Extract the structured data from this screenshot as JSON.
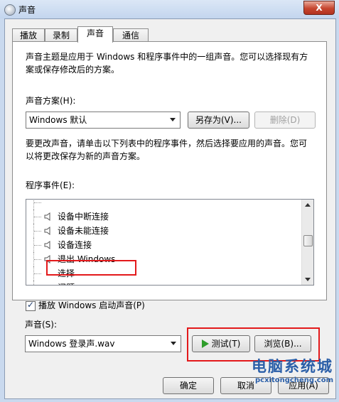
{
  "window": {
    "title": "声音",
    "close_label": "X"
  },
  "tabs": [
    {
      "label": "播放"
    },
    {
      "label": "录制"
    },
    {
      "label": "声音"
    },
    {
      "label": "通信"
    }
  ],
  "description": {
    "line1": "声音主题是应用于 Windows 和程序事件中的一组声音。您可以选择现有方",
    "line2": "案或保存修改后的方案。"
  },
  "scheme": {
    "label": "声音方案(H):",
    "value": "Windows 默认",
    "save_as_label": "另存为(V)...",
    "delete_label": "删除(D)"
  },
  "instructions": {
    "line1": "要更改声音，请单击以下列表中的程序事件，然后选择要应用的声音。您可",
    "line2": "以将更改保存为新的声音方案。"
  },
  "events": {
    "label": "程序事件(E):",
    "items": [
      {
        "label": "",
        "has_icon": false
      },
      {
        "label": "设备中断连接",
        "has_icon": true
      },
      {
        "label": "设备未能连接",
        "has_icon": true
      },
      {
        "label": "设备连接",
        "has_icon": true
      },
      {
        "label": "退出 Windows",
        "has_icon": true
      },
      {
        "label": "选择",
        "has_icon": false
      },
      {
        "label": "问题",
        "has_icon": false
      }
    ]
  },
  "startup": {
    "label": "播放 Windows 启动声音(P)",
    "checked": true
  },
  "sound": {
    "label": "声音(S):",
    "value": "Windows 登录声.wav",
    "test_label": "测试(T)",
    "browse_label": "浏览(B)..."
  },
  "footer": {
    "ok_label": "确定",
    "cancel_label": "取消",
    "apply_label": "应用(A)"
  },
  "watermark": {
    "main": "电脑系统城",
    "sub": "pcxitongcheng.com"
  },
  "colors": {
    "highlight_box": "#e3191b",
    "play_icon": "#2e9d2a"
  }
}
